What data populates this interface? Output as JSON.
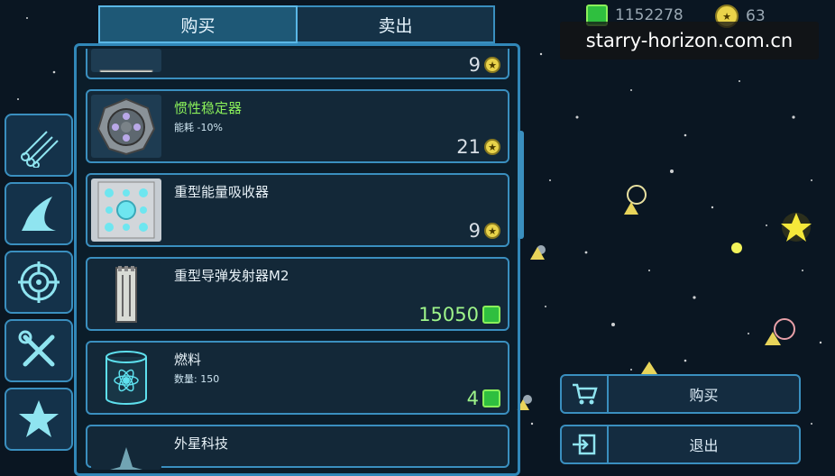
{
  "tabs": {
    "buy": "购买",
    "sell": "卖出"
  },
  "currency": {
    "credits": "1152278",
    "stars": "63"
  },
  "watermark": "starry-horizon.com.cn",
  "items": [
    {
      "name": "",
      "sub": "",
      "price": "9",
      "currency": "star"
    },
    {
      "name": "惯性稳定器",
      "sub": "能耗 -10%",
      "price": "21",
      "currency": "star"
    },
    {
      "name": "重型能量吸收器",
      "sub": "",
      "price": "9",
      "currency": "star"
    },
    {
      "name": "重型导弹发射器M2",
      "sub": "",
      "price": "15050",
      "currency": "credit"
    },
    {
      "name": "燃料",
      "sub": "数量: 150",
      "price": "4",
      "currency": "credit"
    },
    {
      "name": "外星科技",
      "sub": "",
      "price": "",
      "currency": ""
    }
  ],
  "sidebar": [
    {
      "icon": "cargo-pipes-icon"
    },
    {
      "icon": "ship-wing-icon"
    },
    {
      "icon": "target-icon"
    },
    {
      "icon": "tools-icon"
    },
    {
      "icon": "star-icon"
    }
  ],
  "actions": {
    "buy": "购买",
    "exit": "退出"
  },
  "colors": {
    "panel_border": "#3187b8",
    "credit_green": "#2fbf3f",
    "star_yellow": "#e9d34a"
  }
}
